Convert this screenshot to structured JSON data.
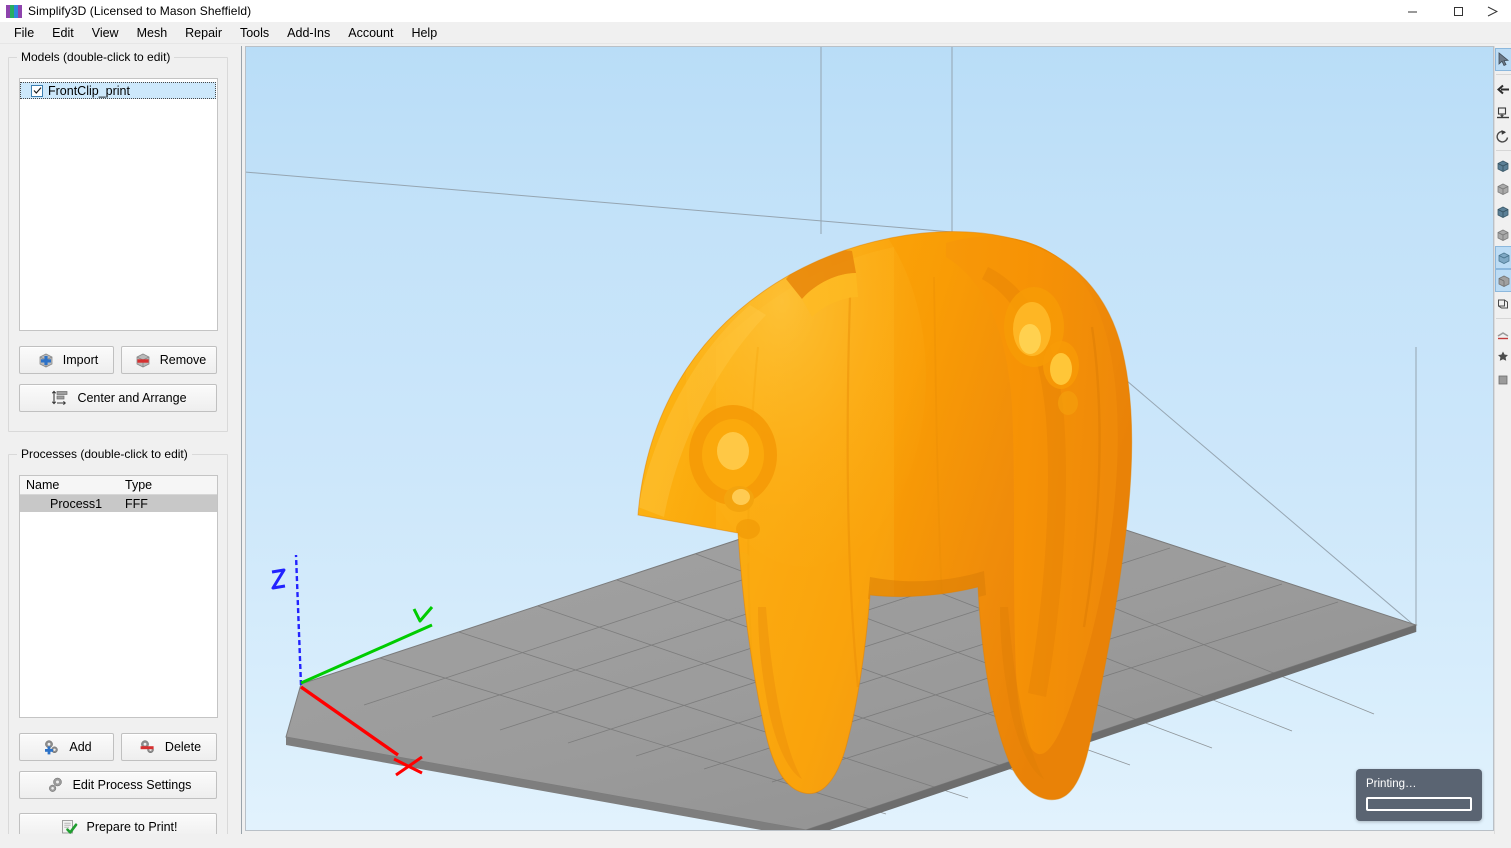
{
  "window": {
    "title": "Simplify3D (Licensed to Mason Sheffield)",
    "app_icon": "simplify3d-logo-icon",
    "controls": [
      {
        "name": "minimize-button",
        "glyph": "minimize-icon"
      },
      {
        "name": "maximize-button",
        "glyph": "maximize-icon"
      },
      {
        "name": "close-button",
        "glyph": "close-icon"
      }
    ]
  },
  "menubar": {
    "items": [
      {
        "label": "File"
      },
      {
        "label": "Edit"
      },
      {
        "label": "View"
      },
      {
        "label": "Mesh"
      },
      {
        "label": "Repair"
      },
      {
        "label": "Tools"
      },
      {
        "label": "Add-Ins"
      },
      {
        "label": "Account"
      },
      {
        "label": "Help"
      }
    ]
  },
  "models_panel": {
    "title": "Models (double-click to edit)",
    "items": [
      {
        "label": "FrontClip_print",
        "checked": true,
        "selected": true
      }
    ],
    "buttons": {
      "import": {
        "label": "Import",
        "icon": "cube-plus-icon"
      },
      "remove": {
        "label": "Remove",
        "icon": "cube-minus-icon"
      },
      "center_and_arrange": {
        "label": "Center and Arrange",
        "icon": "align-arrange-icon"
      }
    }
  },
  "processes_panel": {
    "title": "Processes (double-click to edit)",
    "columns": [
      "Name",
      "Type"
    ],
    "rows": [
      {
        "name": "Process1",
        "type": "FFF",
        "selected": true
      }
    ],
    "buttons": {
      "add": {
        "label": "Add",
        "icon": "gears-plus-icon"
      },
      "delete": {
        "label": "Delete",
        "icon": "gears-minus-icon"
      },
      "edit_process_settings": {
        "label": "Edit Process Settings",
        "icon": "gears-icon"
      },
      "prepare_to_print": {
        "label": "Prepare to Print!",
        "icon": "document-check-icon"
      }
    }
  },
  "viewport": {
    "model_name": "FrontClip_print",
    "model_color": "#f9a300",
    "model_highlight_color": "#ffc233",
    "model_shadow_color": "#e0800a",
    "build_plate_color": "#9e9e9e",
    "grid_line_color": "#6f6f6f",
    "background_top_color": "#b9ddf7",
    "background_bottom_color": "#e2f2fd",
    "axes": [
      {
        "label": "X",
        "color": "#ff0000"
      },
      {
        "label": "Y",
        "color": "#00cc00"
      },
      {
        "label": "Z",
        "color": "#2222ff"
      }
    ]
  },
  "printing_status": {
    "label": "Printing…",
    "progress_percent": 0,
    "panel_color": "#5a6472"
  },
  "right_toolbar": {
    "items": [
      {
        "name": "select-tool",
        "icon": "cursor-icon",
        "active": true
      },
      {
        "name": "pan-tool",
        "icon": "arrow-left-icon",
        "active": false
      },
      {
        "name": "place-surface-tool",
        "icon": "place-on-surface-icon",
        "active": false
      },
      {
        "name": "rotate-tool",
        "icon": "rotate-icon",
        "active": false
      },
      {
        "name": "view-front-tool",
        "icon": "cube-front-icon",
        "active": false
      },
      {
        "name": "view-back-tool",
        "icon": "cube-back-icon",
        "active": false
      },
      {
        "name": "view-left-tool",
        "icon": "cube-left-icon",
        "active": false
      },
      {
        "name": "view-right-tool",
        "icon": "cube-right-icon",
        "active": false
      },
      {
        "name": "view-top-tool",
        "icon": "cube-top-icon",
        "active": true
      },
      {
        "name": "view-bottom-tool",
        "icon": "cube-bottom-icon",
        "active": true
      },
      {
        "name": "view-iso-tool",
        "icon": "cube-iso-icon",
        "active": false
      },
      {
        "name": "cross-section-tool",
        "icon": "cross-section-icon",
        "active": false
      },
      {
        "name": "support-tool",
        "icon": "support-structure-icon",
        "active": false
      },
      {
        "name": "settings-tool",
        "icon": "gear-icon",
        "active": false
      },
      {
        "name": "machine-tool",
        "icon": "printer-icon",
        "active": false
      }
    ]
  }
}
